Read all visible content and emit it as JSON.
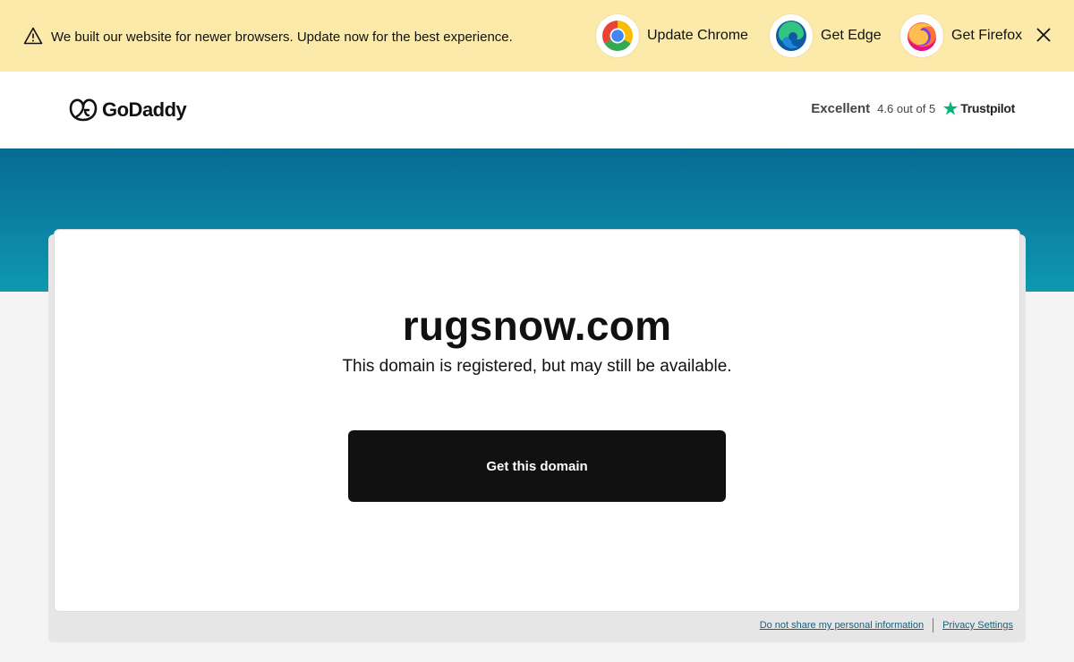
{
  "banner": {
    "message": "We built our website for newer browsers. Update now for the best experience.",
    "chrome_label": "Update Chrome",
    "edge_label": "Get Edge",
    "firefox_label": "Get Firefox"
  },
  "header": {
    "logo_text": "GoDaddy",
    "rating_word": "Excellent",
    "rating_score": "4.6 out of 5",
    "rating_brand": "Trustpilot"
  },
  "main": {
    "domain": "rugsnow.com",
    "subtitle": "This domain is registered, but may still be available.",
    "cta_label": "Get this domain"
  },
  "footer": {
    "privacy_link": "Do not share my personal information",
    "settings_link": "Privacy Settings"
  },
  "colors": {
    "banner_bg": "#fbeaaa",
    "hero_top": "#066a93",
    "hero_bottom": "#0f98b0",
    "cta_bg": "#111111",
    "trustpilot_green": "#00b67a"
  }
}
